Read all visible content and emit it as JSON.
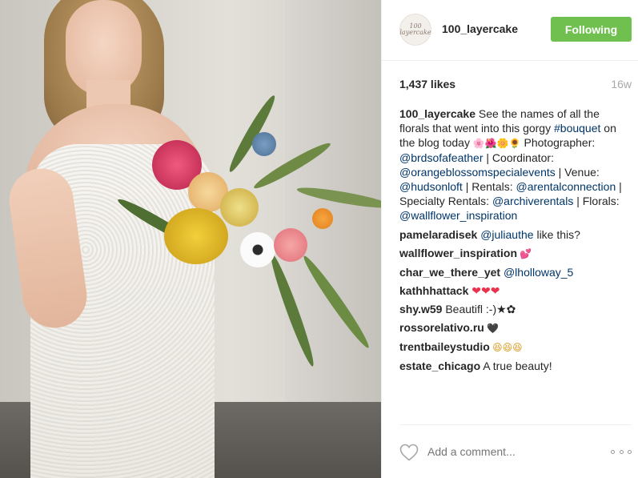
{
  "header": {
    "avatar_text": "100 layercake",
    "username": "100_layercake",
    "follow_label": "Following"
  },
  "stats": {
    "likes": "1,437 likes",
    "age": "16w"
  },
  "caption": {
    "username": "100_layercake",
    "text_1": " See the names of all the florals that went into this gorgy ",
    "hashtag": "#bouquet",
    "text_2": " on the blog today ",
    "emojis": "🌸🌺🌼🌻",
    "text_3": " Photographer: ",
    "mention_1": "@brdsofafeather",
    "text_4": " | Coordinator: ",
    "mention_2": "@orangeblossomspecialevents",
    "text_5": " | Venue: ",
    "mention_3": "@hudsonloft",
    "text_6": " | Rentals: ",
    "mention_4": "@arentalconnection",
    "text_7": " | Specialty Rentals: ",
    "mention_5": "@archiverentals",
    "text_8": " | Florals: ",
    "mention_6": "@wallflower_inspiration"
  },
  "comments": [
    {
      "user": "pamelaradisek",
      "mention": "@juliauthe",
      "text": " like this?"
    },
    {
      "user": "wallflower_inspiration",
      "text": " 💕"
    },
    {
      "user": "char_we_there_yet",
      "mention": "@lholloway_5",
      "text": ""
    },
    {
      "user": "kathhhattack",
      "text": " ❤❤❤"
    },
    {
      "user": "shy.w59",
      "text": " Beautifl :-)★✿"
    },
    {
      "user": "rossorelativo.ru",
      "text": " 🖤"
    },
    {
      "user": "trentbaileystudio",
      "text": " 😆😆😆"
    },
    {
      "user": "estate_chicago",
      "text": " A true beauty!"
    }
  ],
  "footer": {
    "comment_placeholder": "Add a comment...",
    "heart_icon": "heart-outline-icon",
    "more_icon": "more-options-icon"
  },
  "colors": {
    "follow_bg": "#70c050",
    "link": "#003569",
    "muted": "#a5a7aa"
  }
}
